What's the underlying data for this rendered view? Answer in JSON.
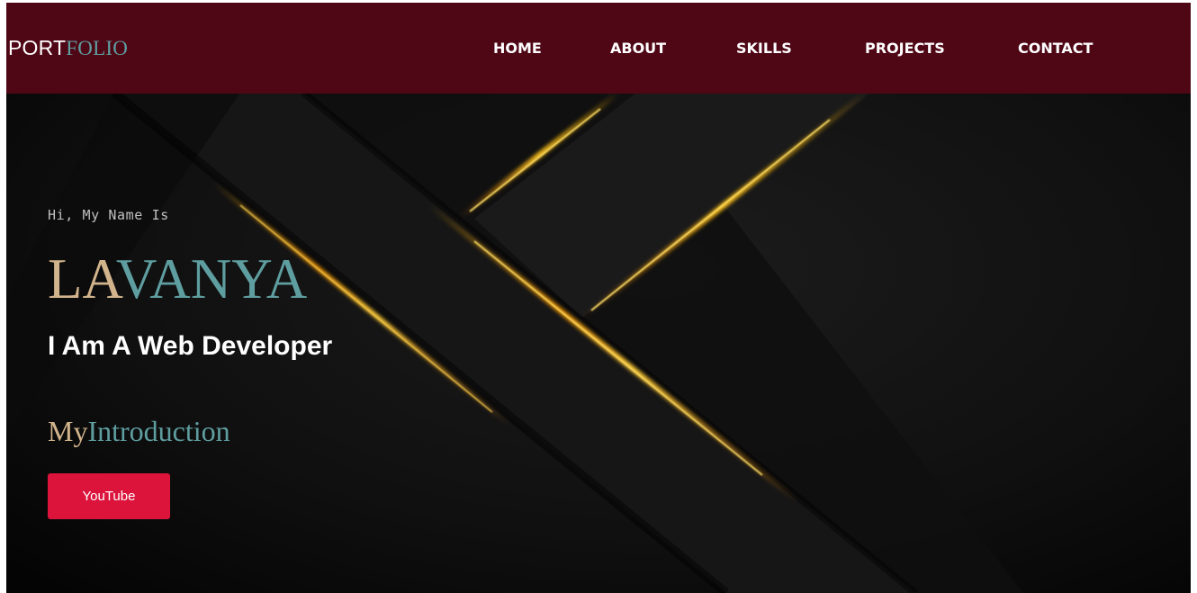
{
  "brand": {
    "part1": "PORT",
    "part2": "FOLIO"
  },
  "nav": {
    "items": [
      {
        "id": "home",
        "label": "HOME"
      },
      {
        "id": "about",
        "label": "ABOUT"
      },
      {
        "id": "skills",
        "label": "SKILLS"
      },
      {
        "id": "projects",
        "label": "PROJECTS"
      },
      {
        "id": "contact",
        "label": "CONTACT"
      }
    ]
  },
  "hero": {
    "greeting": "Hi, My Name Is",
    "name_part1": "LA",
    "name_part2": "VANYA",
    "tagline": "I Am A Web Developer",
    "intro_part1": "My",
    "intro_part2": "Introduction",
    "button_label": "YouTube"
  },
  "colors": {
    "navbar_bg": "#4f0716",
    "accent_tan": "#d2b48c",
    "accent_teal": "#5f9ea0",
    "button_bg": "#dc143c",
    "glow": "#ffb300"
  }
}
